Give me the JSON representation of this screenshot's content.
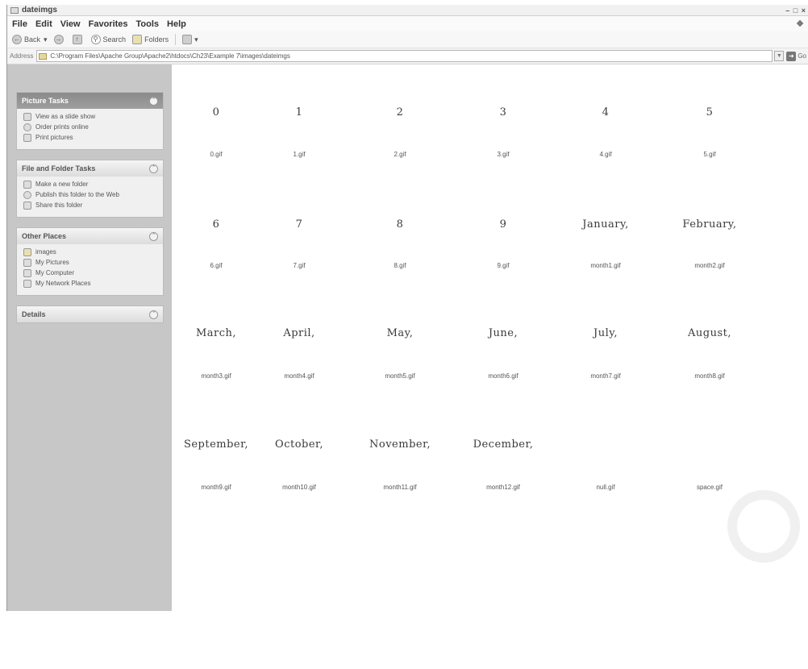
{
  "window": {
    "title": "dateimgs",
    "controls": "– □ ×"
  },
  "menu": [
    "File",
    "Edit",
    "View",
    "Favorites",
    "Tools",
    "Help"
  ],
  "toolbar": {
    "back": "Back",
    "back_arrow": "▾",
    "search": "Search",
    "folders": "Folders",
    "views_arrow": "▾"
  },
  "address": {
    "label": "Address",
    "path": "C:\\Program Files\\Apache Group\\Apache2\\htdocs\\Ch23\\Example 7\\images\\dateimgs",
    "go": "Go"
  },
  "sidebar": {
    "picture_tasks": {
      "title": "Picture Tasks",
      "items": [
        "View as a slide show",
        "Order prints online",
        "Print pictures"
      ]
    },
    "file_folder_tasks": {
      "title": "File and Folder Tasks",
      "items": [
        "Make a new folder",
        "Publish this folder to the Web",
        "Share this folder"
      ]
    },
    "other_places": {
      "title": "Other Places",
      "items": [
        "images",
        "My Pictures",
        "My Computer",
        "My Network Places"
      ]
    },
    "details": {
      "title": "Details"
    }
  },
  "files": [
    {
      "glyph": "0",
      "name": "0.gif"
    },
    {
      "glyph": "1",
      "name": "1.gif"
    },
    {
      "glyph": "2",
      "name": "2.gif"
    },
    {
      "glyph": "3",
      "name": "3.gif"
    },
    {
      "glyph": "4",
      "name": "4.gif"
    },
    {
      "glyph": "5",
      "name": "5.gif"
    },
    {
      "glyph": "6",
      "name": "6.gif"
    },
    {
      "glyph": "7",
      "name": "7.gif"
    },
    {
      "glyph": "8",
      "name": "8.gif"
    },
    {
      "glyph": "9",
      "name": "9.gif"
    },
    {
      "glyph": "January,",
      "name": "month1.gif"
    },
    {
      "glyph": "February,",
      "name": "month2.gif"
    },
    {
      "glyph": "March,",
      "name": "month3.gif"
    },
    {
      "glyph": "April,",
      "name": "month4.gif"
    },
    {
      "glyph": "May,",
      "name": "month5.gif"
    },
    {
      "glyph": "June,",
      "name": "month6.gif"
    },
    {
      "glyph": "July,",
      "name": "month7.gif"
    },
    {
      "glyph": "August,",
      "name": "month8.gif"
    },
    {
      "glyph": "September,",
      "name": "month9.gif"
    },
    {
      "glyph": "October,",
      "name": "month10.gif"
    },
    {
      "glyph": "November,",
      "name": "month11.gif"
    },
    {
      "glyph": "December,",
      "name": "month12.gif"
    },
    {
      "glyph": "",
      "name": "null.gif"
    },
    {
      "glyph": "",
      "name": "space.gif"
    }
  ]
}
